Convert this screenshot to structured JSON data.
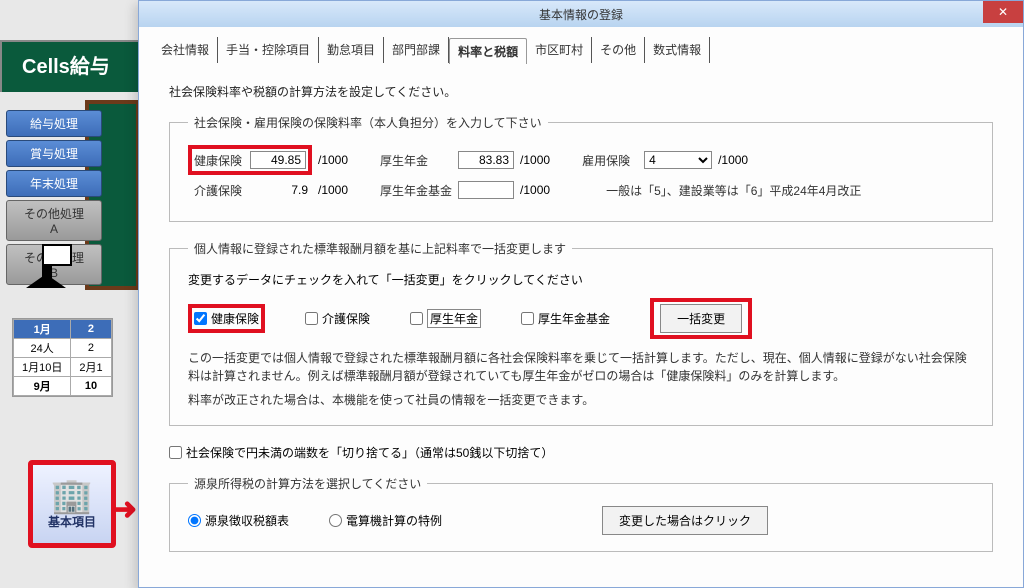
{
  "bg": {
    "title": "Cells給与",
    "side_buttons": {
      "b1": "給与処理",
      "b2": "賞与処理",
      "b3": "年末処理",
      "b4": "その他処理A",
      "b5": "その他処理B"
    },
    "table": {
      "h1": "1月",
      "h2": "2",
      "r1c1": "24人",
      "r1c2": "2",
      "r2c1": "1月10日",
      "r2c2": "2月1",
      "r3c1": "9月",
      "r3c2": "10"
    },
    "basic_label": "基本項目",
    "arrow": "➜"
  },
  "dialog": {
    "title": "基本情報の登録",
    "close": "✕",
    "tabs": {
      "t1": "会社情報",
      "t2": "手当・控除項目",
      "t3": "勤怠項目",
      "t4": "部門部課",
      "t5": "料率と税額",
      "t6": "市区町村",
      "t7": "その他",
      "t8": "数式情報"
    },
    "instruction": "社会保険料率や税額の計算方法を設定してください。",
    "rates": {
      "legend": "社会保険・雇用保険の保険料率（本人負担分）を入力して下さい",
      "kenpo_label": "健康保険",
      "kenpo_val": "49.85",
      "kaigo_label": "介護保険",
      "kaigo_val": "7.9",
      "kousei_label": "厚生年金",
      "kousei_val": "83.83",
      "kikin_label": "厚生年金基金",
      "kikin_val": "",
      "koyou_label": "雇用保険",
      "koyou_val": "4",
      "per1000": "/1000",
      "note": "一般は「5」、建設業等は「6」平成24年4月改正"
    },
    "batch": {
      "legend": "個人情報に登録された標準報酬月額を基に上記料率で一括変更します",
      "row1": "変更するデータにチェックを入れて「一括変更」をクリックしてください",
      "chk1": "健康保険",
      "chk2": "介護保険",
      "chk3": "厚生年金",
      "chk4": "厚生年金基金",
      "btn": "一括変更",
      "desc1": "この一括変更では個人情報で登録された標準報酬月額に各社会保険料率を乗じて一括計算します。ただし、現在、個人情報に登録がない社会保険料は計算されません。例えば標準報酬月額が登録されていても厚生年金がゼロの場合は「健康保険料」のみを計算します。",
      "desc2": "料率が改正された場合は、本機能を使って社員の情報を一括変更できます。"
    },
    "round": {
      "chk_label": "社会保険で円未満の端数を「切り捨てる」（通常は50銭以下切捨て）"
    },
    "tax": {
      "legend": "源泉所得税の計算方法を選択してください",
      "r1": "源泉徴収税額表",
      "r2": "電算機計算の特例",
      "btn": "変更した場合はクリック"
    }
  }
}
